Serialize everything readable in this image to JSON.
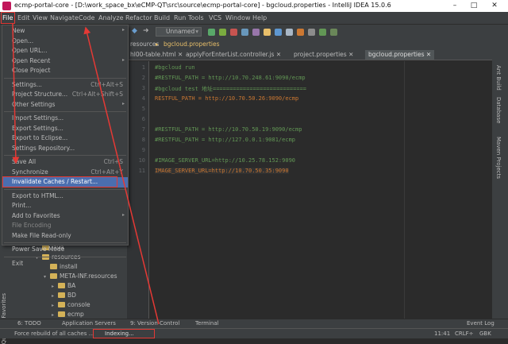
{
  "window": {
    "title": "ecmp-portal-core - [D:\\work_space_bx\\eCMP-QT\\src\\source\\ecmp-portal-core] - bgcloud.properties - IntelliJ IDEA 15.0.6",
    "minimize": "–",
    "maximize": "□",
    "close": "✕"
  },
  "menubar": [
    "File",
    "Edit",
    "View",
    "Navigate",
    "Code",
    "Analyze",
    "Refactor",
    "Build",
    "Run",
    "Tools",
    "VCS",
    "Window",
    "Help"
  ],
  "toolbar": {
    "run_config": "Unnamed"
  },
  "breadcrumb": {
    "part1": "resources",
    "part2": "bgcloud.properties"
  },
  "tabs": [
    "hl00-table.html",
    "applyForEnterList.controller.js",
    "project.properties",
    "bgcloud.properties"
  ],
  "file_menu": [
    {
      "label": "New",
      "shortcut": "",
      "submenu": true
    },
    {
      "label": "Open...",
      "shortcut": ""
    },
    {
      "label": "Open URL...",
      "shortcut": ""
    },
    {
      "label": "Open Recent",
      "shortcut": "",
      "submenu": true
    },
    {
      "label": "Close Project",
      "shortcut": ""
    },
    {
      "sep": true
    },
    {
      "label": "Settings...",
      "shortcut": "Ctrl+Alt+S"
    },
    {
      "label": "Project Structure...",
      "shortcut": "Ctrl+Alt+Shift+S"
    },
    {
      "label": "Other Settings",
      "shortcut": "",
      "submenu": true
    },
    {
      "sep": true
    },
    {
      "label": "Import Settings...",
      "shortcut": ""
    },
    {
      "label": "Export Settings...",
      "shortcut": ""
    },
    {
      "label": "Export to Eclipse...",
      "shortcut": ""
    },
    {
      "label": "Settings Repository...",
      "shortcut": ""
    },
    {
      "sep": true
    },
    {
      "label": "Save All",
      "shortcut": "Ctrl+S"
    },
    {
      "label": "Synchronize",
      "shortcut": "Ctrl+Alt+Y"
    },
    {
      "label": "Invalidate Caches / Restart...",
      "shortcut": "",
      "selected": true
    },
    {
      "sep": true
    },
    {
      "label": "Export to HTML...",
      "shortcut": ""
    },
    {
      "label": "Print...",
      "shortcut": ""
    },
    {
      "label": "Add to Favorites",
      "shortcut": "",
      "submenu": true
    },
    {
      "label": "File Encoding",
      "shortcut": "",
      "disabled": true
    },
    {
      "label": "Make File Read-only",
      "shortcut": ""
    },
    {
      "sep": true
    },
    {
      "label": "Power Save Mode",
      "shortcut": ""
    },
    {
      "sep": true
    },
    {
      "label": "Exit",
      "shortcut": ""
    }
  ],
  "project_tree": [
    "java",
    "resources",
    "install",
    "META-INF.resources",
    "BA",
    "BD",
    "console",
    "ecmp"
  ],
  "editor_lines": [
    {
      "n": "1",
      "t": "#bgcloud run",
      "c": "comment"
    },
    {
      "n": "2",
      "t": "#RESTFUL_PATH = http://10.70.248.61:9090/ecmp",
      "c": "comment"
    },
    {
      "n": "3",
      "t": "#bgcloud test 地址============================",
      "c": "comment"
    },
    {
      "n": "4",
      "t": "RESTFUL_PATH = http://10.70.50.26:9090/ecmp",
      "c": "key"
    },
    {
      "n": "5",
      "t": "",
      "c": "comment"
    },
    {
      "n": "6",
      "t": "",
      "c": "comment"
    },
    {
      "n": "7",
      "t": "#RESTFUL_PATH = http://10.70.50.19:9090/ecmp",
      "c": "comment"
    },
    {
      "n": "8",
      "t": "#RESTFUL_PATH = http://127.0.0.1:9081/ecmp",
      "c": "comment"
    },
    {
      "n": "9",
      "t": "",
      "c": "comment"
    },
    {
      "n": "10",
      "t": "#IMAGE_SERVER_URL=http://10.25.78.152:9090",
      "c": "comment"
    },
    {
      "n": "11",
      "t": "IMAGE_SERVER_URL=http://10.70.50.35:9090",
      "c": "key"
    }
  ],
  "left_tools": {
    "favorites": "2: Favorites",
    "structure": "Quip"
  },
  "right_tools": [
    "Ant Build",
    "Database",
    "Maven Projects"
  ],
  "bottom_tools": {
    "todo": "6: TODO",
    "app_servers": "Application Servers",
    "version_control": "9: Version Control",
    "terminal": "Terminal",
    "event_log": "Event Log"
  },
  "status": {
    "message": "Force rebuild of all caches ...",
    "indexing": "Indexing...",
    "position": "11:41",
    "line_sep": "CRLF÷",
    "encoding": "GBK"
  },
  "colors": {
    "annotation": "#e53935",
    "selection": "#4b6eaf"
  }
}
